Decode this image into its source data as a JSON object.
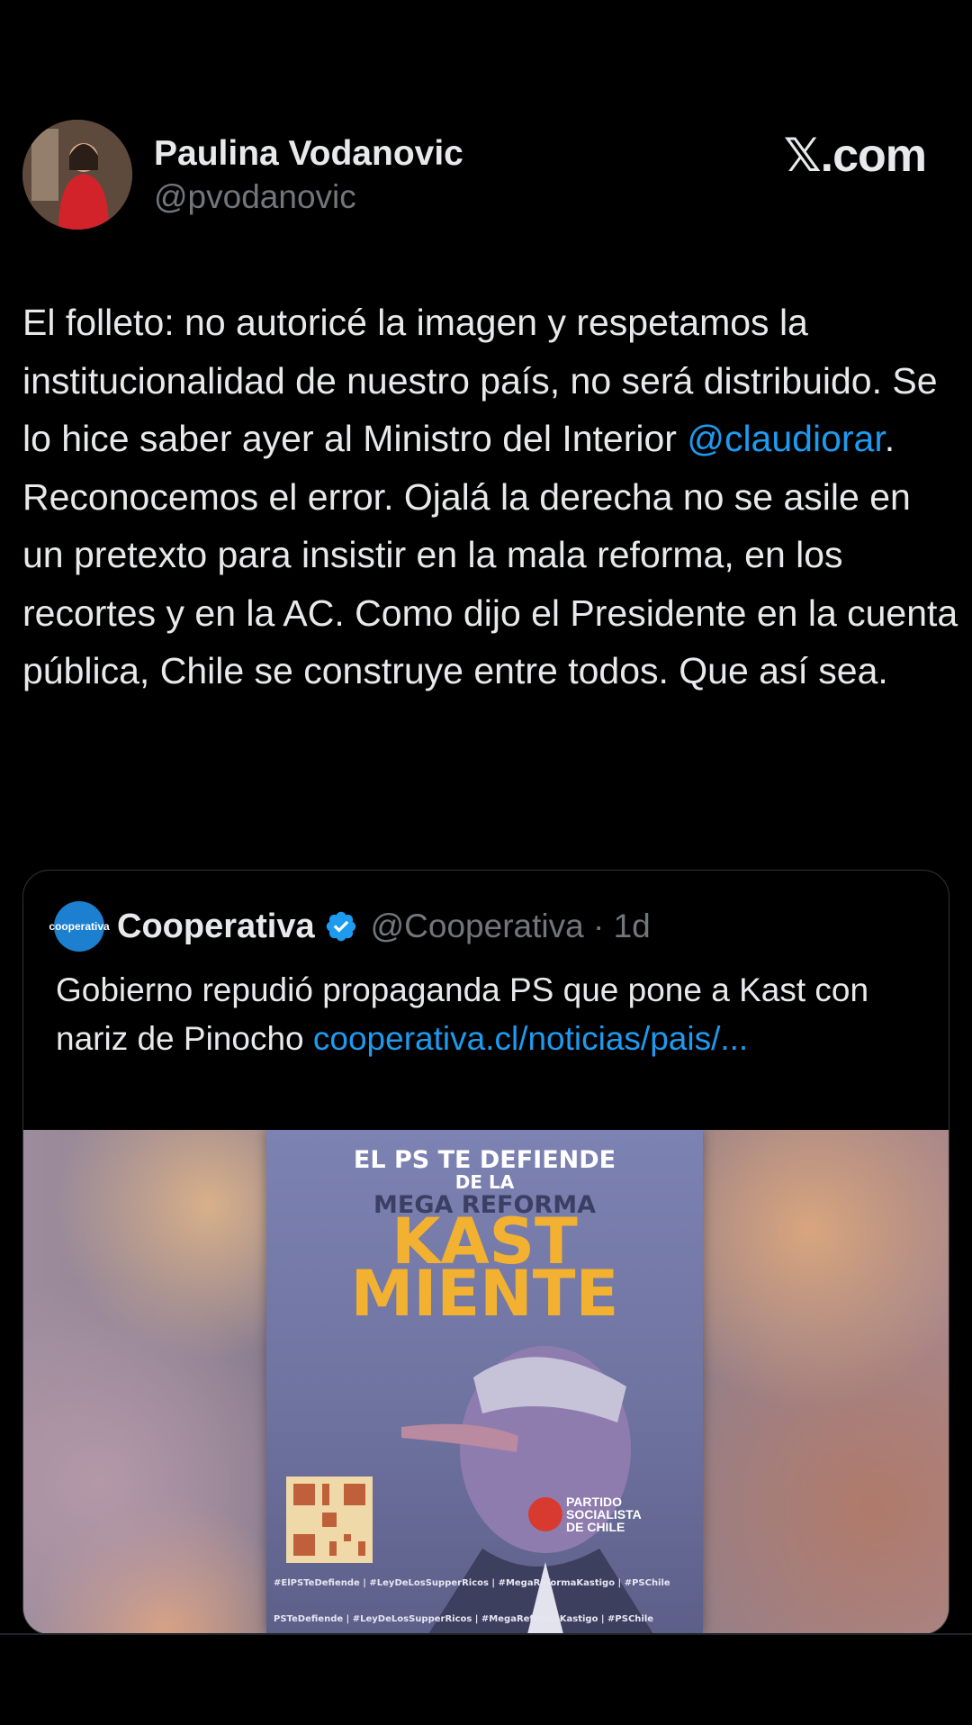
{
  "author": {
    "display_name": "Paulina Vodanovic",
    "handle": "@pvodanovic"
  },
  "brand": "𝕏.com",
  "tweet": {
    "text_before_mention": "El folleto: no autoricé  la imagen  y respetamos  la institucionalidad de nuestro país,  no será distribuido. Se lo hice saber ayer al Ministro del Interior ",
    "mention": "@claudiorar",
    "text_after_mention": ". Reconocemos el error. Ojalá la derecha no se asile en un pretexto para insistir en la mala reforma, en los recortes y en la AC.  Como dijo el Presidente en la cuenta pública, Chile se construye entre todos. Que así sea."
  },
  "quoted": {
    "avatar_text": "cooperativa",
    "name": "Cooperativa",
    "verified_icon": "verified-badge-icon",
    "meta": "@Cooperativa · 1d",
    "text": "Gobierno repudió propaganda PS que pone a Kast con nariz de Pinocho ",
    "link": "cooperativa.cl/noticias/pais/..."
  },
  "poster": {
    "line1": "EL PS TE DEFIENDE",
    "line2": "DE LA",
    "line3": "MEGA REFORMA",
    "kast": "KAST",
    "miente": "MIENTE",
    "party_line1": "PARTIDO",
    "party_line2": "SOCIALISTA",
    "party_line3": "DE CHILE",
    "tags": "#ElPSTeDefiende | #LeyDeLosSupperRicos | #MegaReformaKastigo | #PSChile",
    "tags_bottom": "PSTeDefiende | #LeyDeLosSupperRicos | #MegaReformaKastigo | #PSChile"
  }
}
